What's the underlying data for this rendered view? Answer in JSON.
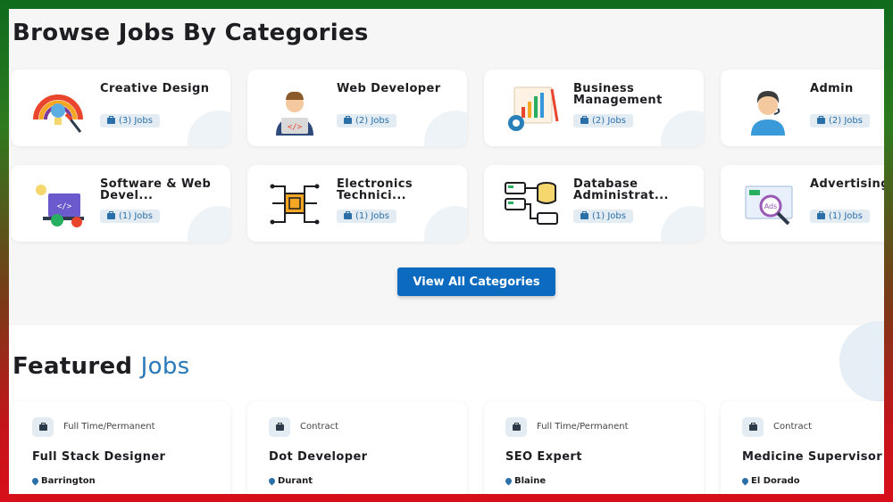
{
  "browse": {
    "title": "Browse Jobs By Categories",
    "categories": [
      {
        "name": "Creative Design",
        "jobs": "(3) Jobs",
        "icon": "creative-design-icon"
      },
      {
        "name": "Web Developer",
        "jobs": "(2) Jobs",
        "icon": "web-developer-icon"
      },
      {
        "name": "Business Management",
        "jobs": "(2) Jobs",
        "icon": "business-management-icon"
      },
      {
        "name": "Admin",
        "jobs": "(2) Jobs",
        "icon": "admin-icon"
      },
      {
        "name": "Software & Web Devel...",
        "jobs": "(1) Jobs",
        "icon": "software-web-icon"
      },
      {
        "name": "Electronics Technici...",
        "jobs": "(1) Jobs",
        "icon": "electronics-icon"
      },
      {
        "name": "Database Administrat...",
        "jobs": "(1) Jobs",
        "icon": "database-icon"
      },
      {
        "name": "Advertising",
        "jobs": "(1) Jobs",
        "icon": "advertising-icon"
      }
    ],
    "view_all_label": "View All Categories"
  },
  "featured": {
    "title_main": "Featured",
    "title_accent": "Jobs",
    "jobs": [
      {
        "type": "Full Time/Permanent",
        "title": "Full Stack Designer",
        "location": "Barrington"
      },
      {
        "type": "Contract",
        "title": "Dot Developer",
        "location": "Durant"
      },
      {
        "type": "Full Time/Permanent",
        "title": "SEO Expert",
        "location": "Blaine"
      },
      {
        "type": "Contract",
        "title": "Medicine Supervisor",
        "location": "El Dorado"
      }
    ]
  },
  "colors": {
    "accent": "#0d6bbf",
    "badge_bg": "#e4ecf3",
    "badge_text": "#2a6fa8"
  }
}
